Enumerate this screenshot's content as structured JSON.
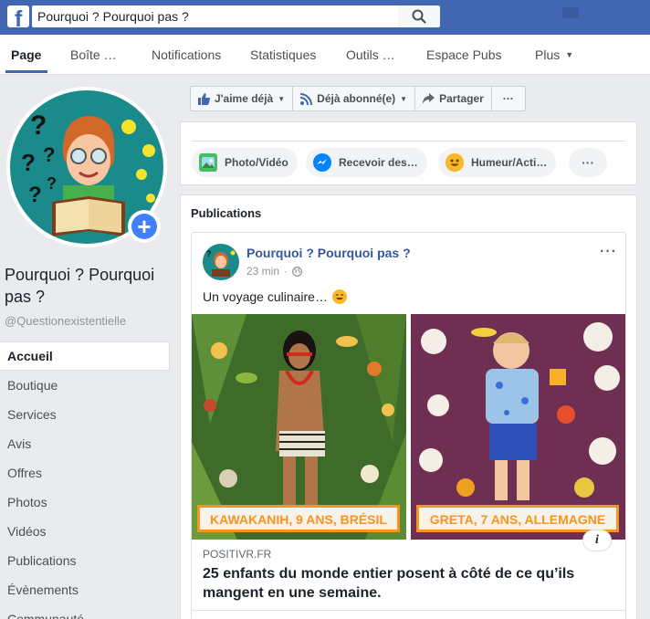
{
  "topbar": {
    "logo": "f",
    "search_value": "Pourquoi ? Pourquoi pas ?",
    "search_icon": "search-icon"
  },
  "tabs": [
    {
      "label": "Page",
      "active": true
    },
    {
      "label": "Boîte …"
    },
    {
      "label": "Notifications"
    },
    {
      "label": "Statistiques"
    },
    {
      "label": "Outils …"
    },
    {
      "label": "Espace Pubs"
    },
    {
      "label": "Plus"
    }
  ],
  "page": {
    "name": "Pourquoi ? Pourquoi pas ?",
    "handle": "@Questionexistentielle",
    "add_photo_label": "+"
  },
  "sidebar": {
    "items": [
      {
        "label": "Accueil",
        "active": true
      },
      {
        "label": "Boutique"
      },
      {
        "label": "Services"
      },
      {
        "label": "Avis"
      },
      {
        "label": "Offres"
      },
      {
        "label": "Photos"
      },
      {
        "label": "Vidéos"
      },
      {
        "label": "Publications"
      },
      {
        "label": "Évènements"
      },
      {
        "label": "Communauté"
      }
    ]
  },
  "actions": {
    "like": "J'aime déjà",
    "follow": "Déjà abonné(e)",
    "share": "Partager",
    "more": "···"
  },
  "composer": {
    "photo_video": "Photo/Vidéo",
    "messages": "Recevoir des…",
    "feeling": "Humeur/Acti…",
    "more": "···"
  },
  "publications": {
    "title": "Publications",
    "post": {
      "author": "Pourquoi ? Pourquoi pas ?",
      "time": "23 min",
      "more": "···",
      "text": "Un voyage culinaire…",
      "image_captions": [
        "KAWAKANIH, 9 ANS, BRÉSIL",
        "GRETA, 7 ANS, ALLEMAGNE"
      ],
      "info": "i",
      "link_domain": "POSITIVR.FR",
      "link_title": "25 enfants du monde entier posent à côté de ce qu’ils mangent en une semaine."
    }
  },
  "colors": {
    "brand": "#4267b2",
    "link": "#365899",
    "accent_orange": "#f7941d"
  }
}
